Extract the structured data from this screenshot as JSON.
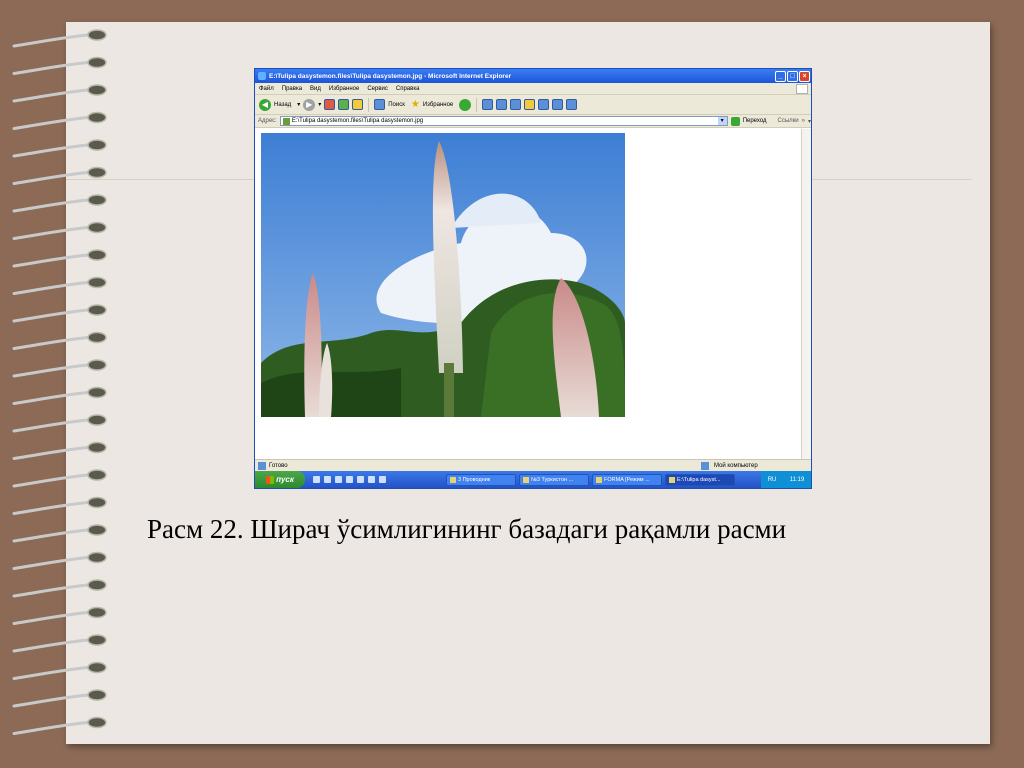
{
  "window": {
    "title": "E:\\Tulipa dasystemon.files\\Tulipa dasystemon.jpg - Microsoft Internet Explorer"
  },
  "menu": {
    "items": [
      "Файл",
      "Правка",
      "Вид",
      "Избранное",
      "Сервис",
      "Справка"
    ]
  },
  "toolbar": {
    "back_label": "Назад",
    "search_label": "Поиск",
    "favorites_label": "Избранное"
  },
  "address": {
    "label": "Адрес:",
    "value": "E:\\Tulipa dasystemon.files\\Tulipa dasystemon.jpg",
    "go_label": "Переход",
    "links_label": "Ссылки"
  },
  "status": {
    "text": "Готово",
    "zone": "Мой компьютер"
  },
  "taskbar": {
    "start_label": "пуск",
    "tasks": [
      "3 Проводник",
      "№3 Туркистон ...",
      "FORMA [Режим ...",
      "E:\\Tulipa dasyst..."
    ],
    "tray_lang": "RU",
    "clock": "11:19"
  },
  "caption": "Расм 22. Ширач ўсимлигининг базадаги рақамли расми"
}
